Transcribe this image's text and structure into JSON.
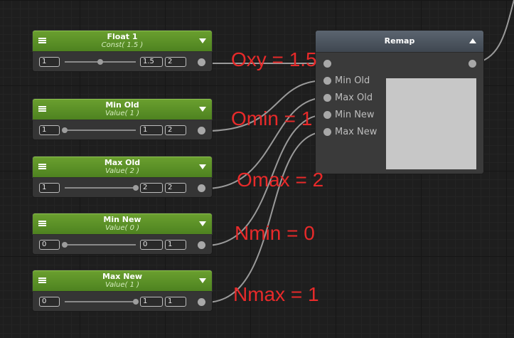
{
  "nodes": [
    {
      "title": "Float 1",
      "subtitle": "Const( 1.5 )",
      "value": "1",
      "min": "1.5",
      "max": "2",
      "slider_fraction": 0.5
    },
    {
      "title": "Min Old",
      "subtitle": "Value( 1 )",
      "value": "1",
      "min": "1",
      "max": "2",
      "slider_fraction": 0.0
    },
    {
      "title": "Max Old",
      "subtitle": "Value( 2 )",
      "value": "1",
      "min": "2",
      "max": "2",
      "slider_fraction": 1.0
    },
    {
      "title": "Min New",
      "subtitle": "Value( 0 )",
      "value": "0",
      "min": "0",
      "max": "1",
      "slider_fraction": 0.0
    },
    {
      "title": "Max New",
      "subtitle": "Value( 1 )",
      "value": "0",
      "min": "1",
      "max": "1",
      "slider_fraction": 1.0
    }
  ],
  "remap": {
    "title": "Remap",
    "inputs": [
      "Min Old",
      "Max Old",
      "Min New",
      "Max New"
    ]
  },
  "annotations": {
    "oxy": "Oxy = 1.5",
    "omin": "Omin = 1",
    "omax": "Omax = 2",
    "nmin": "Nmin = 0",
    "nmax": "Nmax = 1"
  },
  "colors": {
    "node_header": "#5a9127",
    "annotation": "#e82a2a",
    "wire": "#9a9a9a",
    "canvas": "#1e1e1e"
  }
}
